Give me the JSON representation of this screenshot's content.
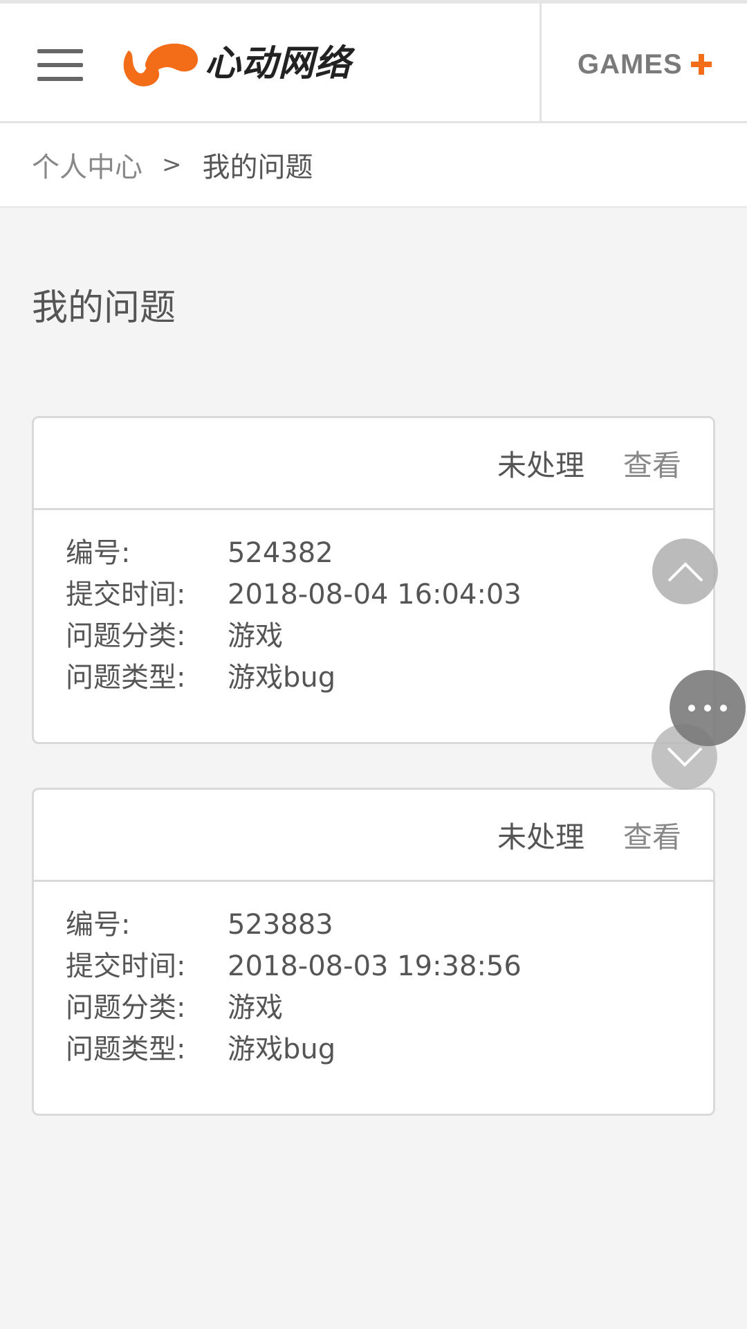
{
  "header": {
    "brand_name": "心动网络",
    "games_label": "GAMES",
    "colors": {
      "brand_orange": "#f36c17",
      "header_bg": "#ffffff",
      "page_bg": "#f4f4f4"
    }
  },
  "breadcrumb": {
    "home": "个人中心",
    "separator": ">",
    "current": "我的问题"
  },
  "page": {
    "title": "我的问题"
  },
  "tickets": [
    {
      "status": "未处理",
      "view_label": "查看",
      "fields": [
        {
          "label": "编号:",
          "value": "524382"
        },
        {
          "label": "提交时间:",
          "value": "2018-08-04 16:04:03"
        },
        {
          "label": "问题分类:",
          "value": "游戏"
        },
        {
          "label": "问题类型:",
          "value": "游戏bug"
        }
      ]
    },
    {
      "status": "未处理",
      "view_label": "查看",
      "fields": [
        {
          "label": "编号:",
          "value": "523883"
        },
        {
          "label": "提交时间:",
          "value": "2018-08-03 19:38:56"
        },
        {
          "label": "问题分类:",
          "value": "游戏"
        },
        {
          "label": "问题类型:",
          "value": "游戏bug"
        }
      ]
    }
  ],
  "floating_buttons": {
    "up_icon": "chevron-up-icon",
    "more_icon": "more-dots-icon",
    "down_icon": "chevron-down-icon"
  }
}
